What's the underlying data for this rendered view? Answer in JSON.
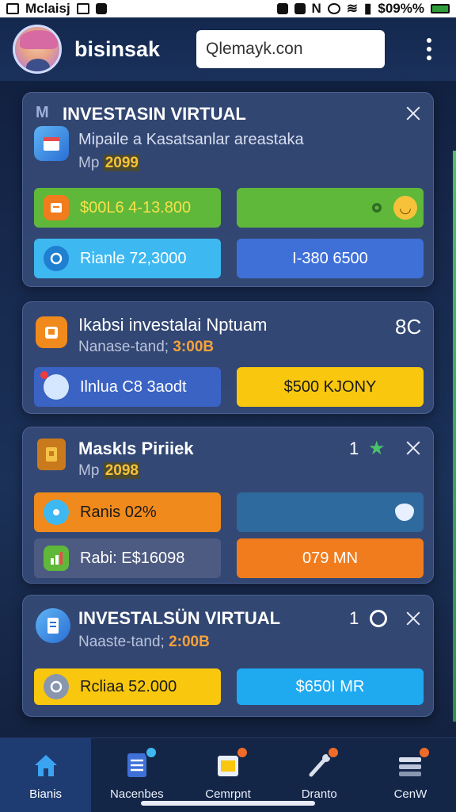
{
  "status_bar": {
    "carrier": "Mclaisj",
    "battery_text": "$09%%"
  },
  "header": {
    "app_name": "bisinsak",
    "search_value": "Qlemayk.con"
  },
  "cards": [
    {
      "title": "INVESTASIN VIRTUAL",
      "title_prefix": "M",
      "subtitle": "Mipaile a Kasatsanlar areastaka",
      "meta_label": "Mp",
      "meta_value": "2099",
      "buttons": [
        "$00L6 4-13.800",
        "",
        "Rianle 72,3000",
        "I-380 6500"
      ]
    },
    {
      "title": "Ikabsi investalai Nptuam",
      "meta_label": "Nanase-tand;",
      "meta_value": "3:00B",
      "count": "8C",
      "buttons": [
        "Ilnlua C8 3aodt",
        "$500 KJONY"
      ]
    },
    {
      "title": "Maskls Piriiek",
      "meta_label": "Mp",
      "meta_value": "2098",
      "count": "1",
      "buttons": [
        "Ranis 02%",
        "",
        "Rabi: E$16098",
        "079 MN"
      ]
    },
    {
      "title": "INVESTALSÜN VIRTUAL",
      "meta_label": "Naaste-tand;",
      "meta_value": "2:00B",
      "count": "1",
      "buttons": [
        "Rcliaa 52.000",
        "$650I MR"
      ]
    }
  ],
  "nav": [
    {
      "label": "Bianis",
      "icon": "home-icon",
      "active": true
    },
    {
      "label": "Nacenbes",
      "icon": "document-icon"
    },
    {
      "label": "Cemrpnt",
      "icon": "clipboard-icon"
    },
    {
      "label": "Dranto",
      "icon": "wrench-icon"
    },
    {
      "label": "CenW",
      "icon": "stack-icon"
    }
  ],
  "colors": {
    "accent_orange": "#f08a1c",
    "green": "#5fb83a",
    "blue": "#3f70d8",
    "sky": "#3db8f0",
    "yellow": "#f9c80e",
    "orange": "#f07c1e"
  }
}
